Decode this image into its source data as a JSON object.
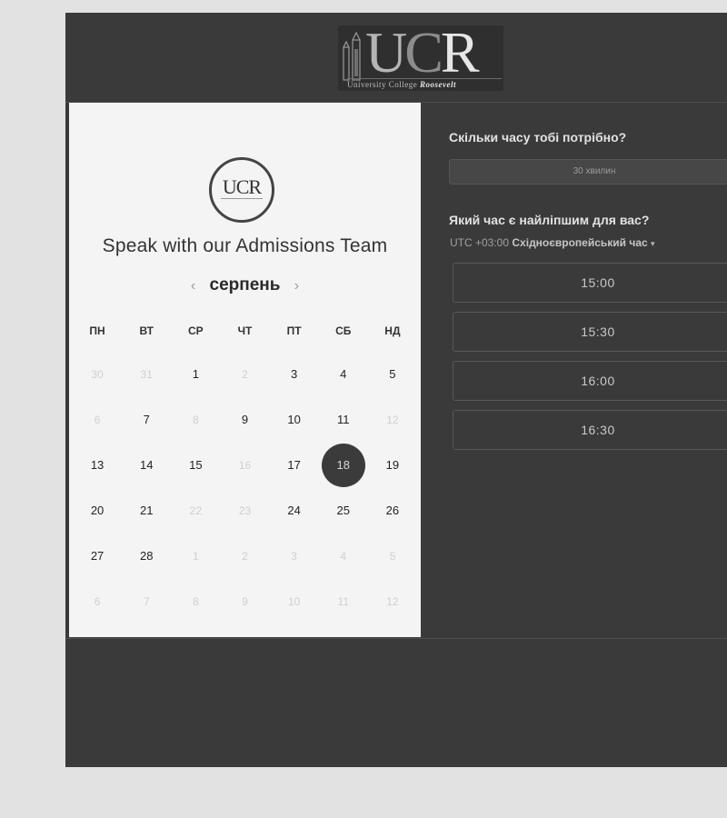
{
  "logo": {
    "letters_u": "U",
    "letters_c": "C",
    "letters_r": "R",
    "subline_plain": "University College ",
    "subline_emph": "Roosevelt"
  },
  "calendar": {
    "badge_text": "UCR",
    "title": "Speak with our Admissions Team",
    "month": "серпень",
    "prev": "‹",
    "next": "›",
    "weekdays": [
      "ПН",
      "ВТ",
      "СР",
      "ЧТ",
      "ПТ",
      "СБ",
      "НД"
    ],
    "weeks": [
      [
        {
          "d": "30",
          "m": true
        },
        {
          "d": "31",
          "m": true
        },
        {
          "d": "1",
          "m": false
        },
        {
          "d": "2",
          "m": true
        },
        {
          "d": "3",
          "m": false
        },
        {
          "d": "4",
          "m": false
        },
        {
          "d": "5",
          "m": false
        }
      ],
      [
        {
          "d": "6",
          "m": true
        },
        {
          "d": "7",
          "m": false
        },
        {
          "d": "8",
          "m": true
        },
        {
          "d": "9",
          "m": false
        },
        {
          "d": "10",
          "m": false
        },
        {
          "d": "11",
          "m": false
        },
        {
          "d": "12",
          "m": true
        }
      ],
      [
        {
          "d": "13",
          "m": false
        },
        {
          "d": "14",
          "m": false
        },
        {
          "d": "15",
          "m": false
        },
        {
          "d": "16",
          "m": true
        },
        {
          "d": "17",
          "m": false
        },
        {
          "d": "18",
          "m": false,
          "sel": true
        },
        {
          "d": "19",
          "m": false
        }
      ],
      [
        {
          "d": "20",
          "m": false
        },
        {
          "d": "21",
          "m": false
        },
        {
          "d": "22",
          "m": true
        },
        {
          "d": "23",
          "m": true
        },
        {
          "d": "24",
          "m": false
        },
        {
          "d": "25",
          "m": false
        },
        {
          "d": "26",
          "m": false
        }
      ],
      [
        {
          "d": "27",
          "m": false
        },
        {
          "d": "28",
          "m": false
        },
        {
          "d": "1",
          "m": true
        },
        {
          "d": "2",
          "m": true
        },
        {
          "d": "3",
          "m": true
        },
        {
          "d": "4",
          "m": true
        },
        {
          "d": "5",
          "m": true
        }
      ],
      [
        {
          "d": "6",
          "m": true
        },
        {
          "d": "7",
          "m": true
        },
        {
          "d": "8",
          "m": true
        },
        {
          "d": "9",
          "m": true
        },
        {
          "d": "10",
          "m": true
        },
        {
          "d": "11",
          "m": true
        },
        {
          "d": "12",
          "m": true
        }
      ]
    ]
  },
  "booking": {
    "duration_question": "Скільки часу тобі потрібно?",
    "duration_value": "30 хвилин",
    "time_question": "Який час є найліпшим для вас?",
    "tz_offset": "UTC +03:00",
    "tz_name": "Східноєвропейський час",
    "tz_caret": "▾",
    "slots": [
      "15:00",
      "15:30",
      "16:00",
      "16:30"
    ]
  },
  "colors": {
    "page_bg": "#e2e2e2",
    "frame_bg": "#3a3a3a",
    "calendar_bg": "#f4f4f4",
    "selected_day": "#3b3b3b"
  }
}
